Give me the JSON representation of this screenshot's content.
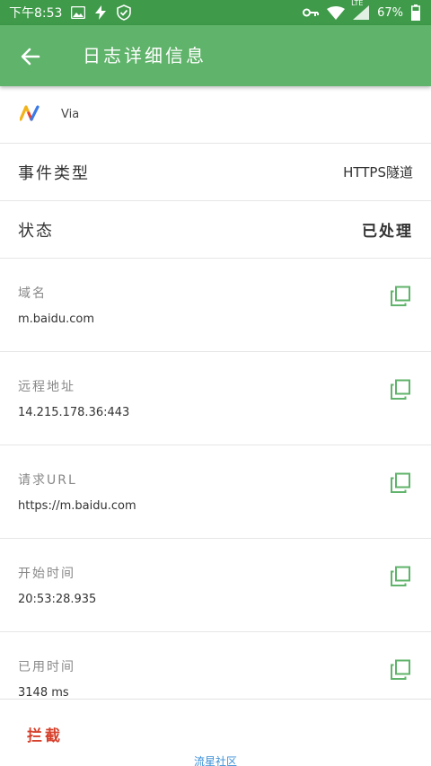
{
  "status_bar": {
    "time": "下午8:53",
    "battery": "67%",
    "network_badge": "LTE",
    "icons": [
      "gallery-icon",
      "flash-icon",
      "shield-check-icon",
      "key-icon",
      "wifi-icon",
      "signal-icon",
      "battery-icon"
    ]
  },
  "header": {
    "title": "日志详细信息",
    "back_icon": "arrow-left-icon"
  },
  "app": {
    "name": "Via",
    "logo_colors": [
      "#f2b21a",
      "#e8452c",
      "#3b7be8"
    ]
  },
  "event_type": {
    "label": "事件类型",
    "value": "HTTPS隧道"
  },
  "status": {
    "label": "状态",
    "value": "已处理"
  },
  "details": [
    {
      "label": "域名",
      "value": "m.baidu.com"
    },
    {
      "label": "远程地址",
      "value": "14.215.178.36:443"
    },
    {
      "label": "请求URL",
      "value": "https://m.baidu.com"
    },
    {
      "label": "开始时间",
      "value": "20:53:28.935"
    },
    {
      "label": "已用时间",
      "value": "3148 ms"
    }
  ],
  "footer": {
    "block_label": "拦截",
    "watermark": "流星社区"
  },
  "colors": {
    "status_bar": "#3f9a4a",
    "app_bar": "#5fb36a",
    "accent_green": "#5fb36a",
    "block_red": "#d6402b",
    "watermark_blue": "#3b8fd6"
  }
}
